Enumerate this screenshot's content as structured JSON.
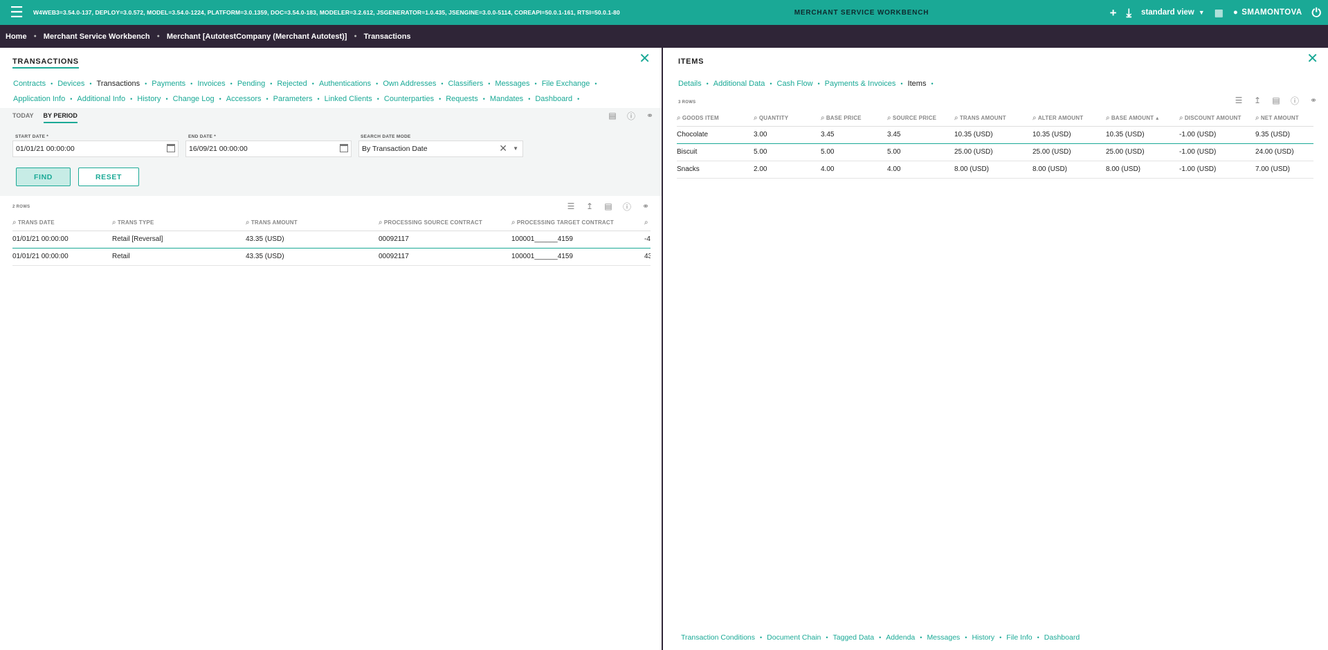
{
  "topbar": {
    "versions": "W4WEB3=3.54.0-137, DEPLOY=3.0.572, MODEL=3.54.0-1224, PLATFORM=3.0.1359, DOC=3.54.0-183, MODELER=3.2.612, JSGENERATOR=1.0.435, JSENGINE=3.0.0-5114, COREAPI=50.0.1-161, RTSI=50.0.1-80",
    "app_title": "MERCHANT SERVICE WORKBENCH",
    "view": "standard view",
    "user": "SMAMONTOVA",
    "accent": "#1aa996"
  },
  "breadcrumb": [
    "Home",
    "Merchant Service Workbench",
    "Merchant [AutotestCompany (Merchant Autotest)]",
    "Transactions"
  ],
  "left": {
    "title": "TRANSACTIONS",
    "tabs_row1": [
      "Contracts",
      "Devices",
      "Transactions",
      "Payments",
      "Invoices",
      "Pending",
      "Rejected",
      "Authentications",
      "Own Addresses",
      "Classifiers",
      "Messages",
      "File Exchange"
    ],
    "tabs_row2": [
      "Application Info",
      "Additional Info",
      "History",
      "Change Log",
      "Accessors",
      "Parameters",
      "Linked Clients",
      "Counterparties",
      "Requests",
      "Mandates",
      "Dashboard"
    ],
    "active_tab": "Transactions",
    "filter_tabs": [
      "TODAY",
      "BY PERIOD"
    ],
    "filter": {
      "start_label": "START DATE *",
      "start_value": "01/01/21 00:00:00",
      "end_label": "END DATE *",
      "end_value": "16/09/21 00:00:00",
      "mode_label": "SEARCH DATE MODE",
      "mode_value": "By Transaction Date"
    },
    "find_label": "FIND",
    "reset_label": "RESET",
    "rows_count": "2 ROWS",
    "columns": [
      "TRANS DATE",
      "TRANS TYPE",
      "TRANS AMOUNT",
      "PROCESSING SOURCE CONTRACT",
      "PROCESSING TARGET CONTRACT",
      ""
    ],
    "rows": [
      [
        "01/01/21 00:00:00",
        "Retail [Reversal]",
        "43.35 (USD)",
        "00092117",
        "100001______4159",
        "-4"
      ],
      [
        "01/01/21 00:00:00",
        "Retail",
        "43.35 (USD)",
        "00092117",
        "100001______4159",
        "43"
      ]
    ]
  },
  "right": {
    "title": "ITEMS",
    "tabs": [
      "Details",
      "Additional Data",
      "Cash Flow",
      "Payments & Invoices",
      "Items"
    ],
    "active_tab": "Items",
    "rows_count": "3 ROWS",
    "columns": [
      "GOODS ITEM",
      "QUANTITY",
      "BASE PRICE",
      "SOURCE PRICE",
      "TRANS AMOUNT",
      "ALTER AMOUNT",
      "BASE AMOUNT",
      "DISCOUNT AMOUNT",
      "NET AMOUNT"
    ],
    "rows": [
      [
        "Chocolate",
        "3.00",
        "3.45",
        "3.45",
        "10.35 (USD)",
        "10.35 (USD)",
        "10.35 (USD)",
        "-1.00 (USD)",
        "9.35 (USD)"
      ],
      [
        "Biscuit",
        "5.00",
        "5.00",
        "5.00",
        "25.00 (USD)",
        "25.00 (USD)",
        "25.00 (USD)",
        "-1.00 (USD)",
        "24.00 (USD)"
      ],
      [
        "Snacks",
        "2.00",
        "4.00",
        "4.00",
        "8.00 (USD)",
        "8.00 (USD)",
        "8.00 (USD)",
        "-1.00 (USD)",
        "7.00 (USD)"
      ]
    ],
    "bottom_links": [
      "Transaction Conditions",
      "Document Chain",
      "Tagged Data",
      "Addenda",
      "Messages",
      "History",
      "File Info",
      "Dashboard"
    ]
  }
}
